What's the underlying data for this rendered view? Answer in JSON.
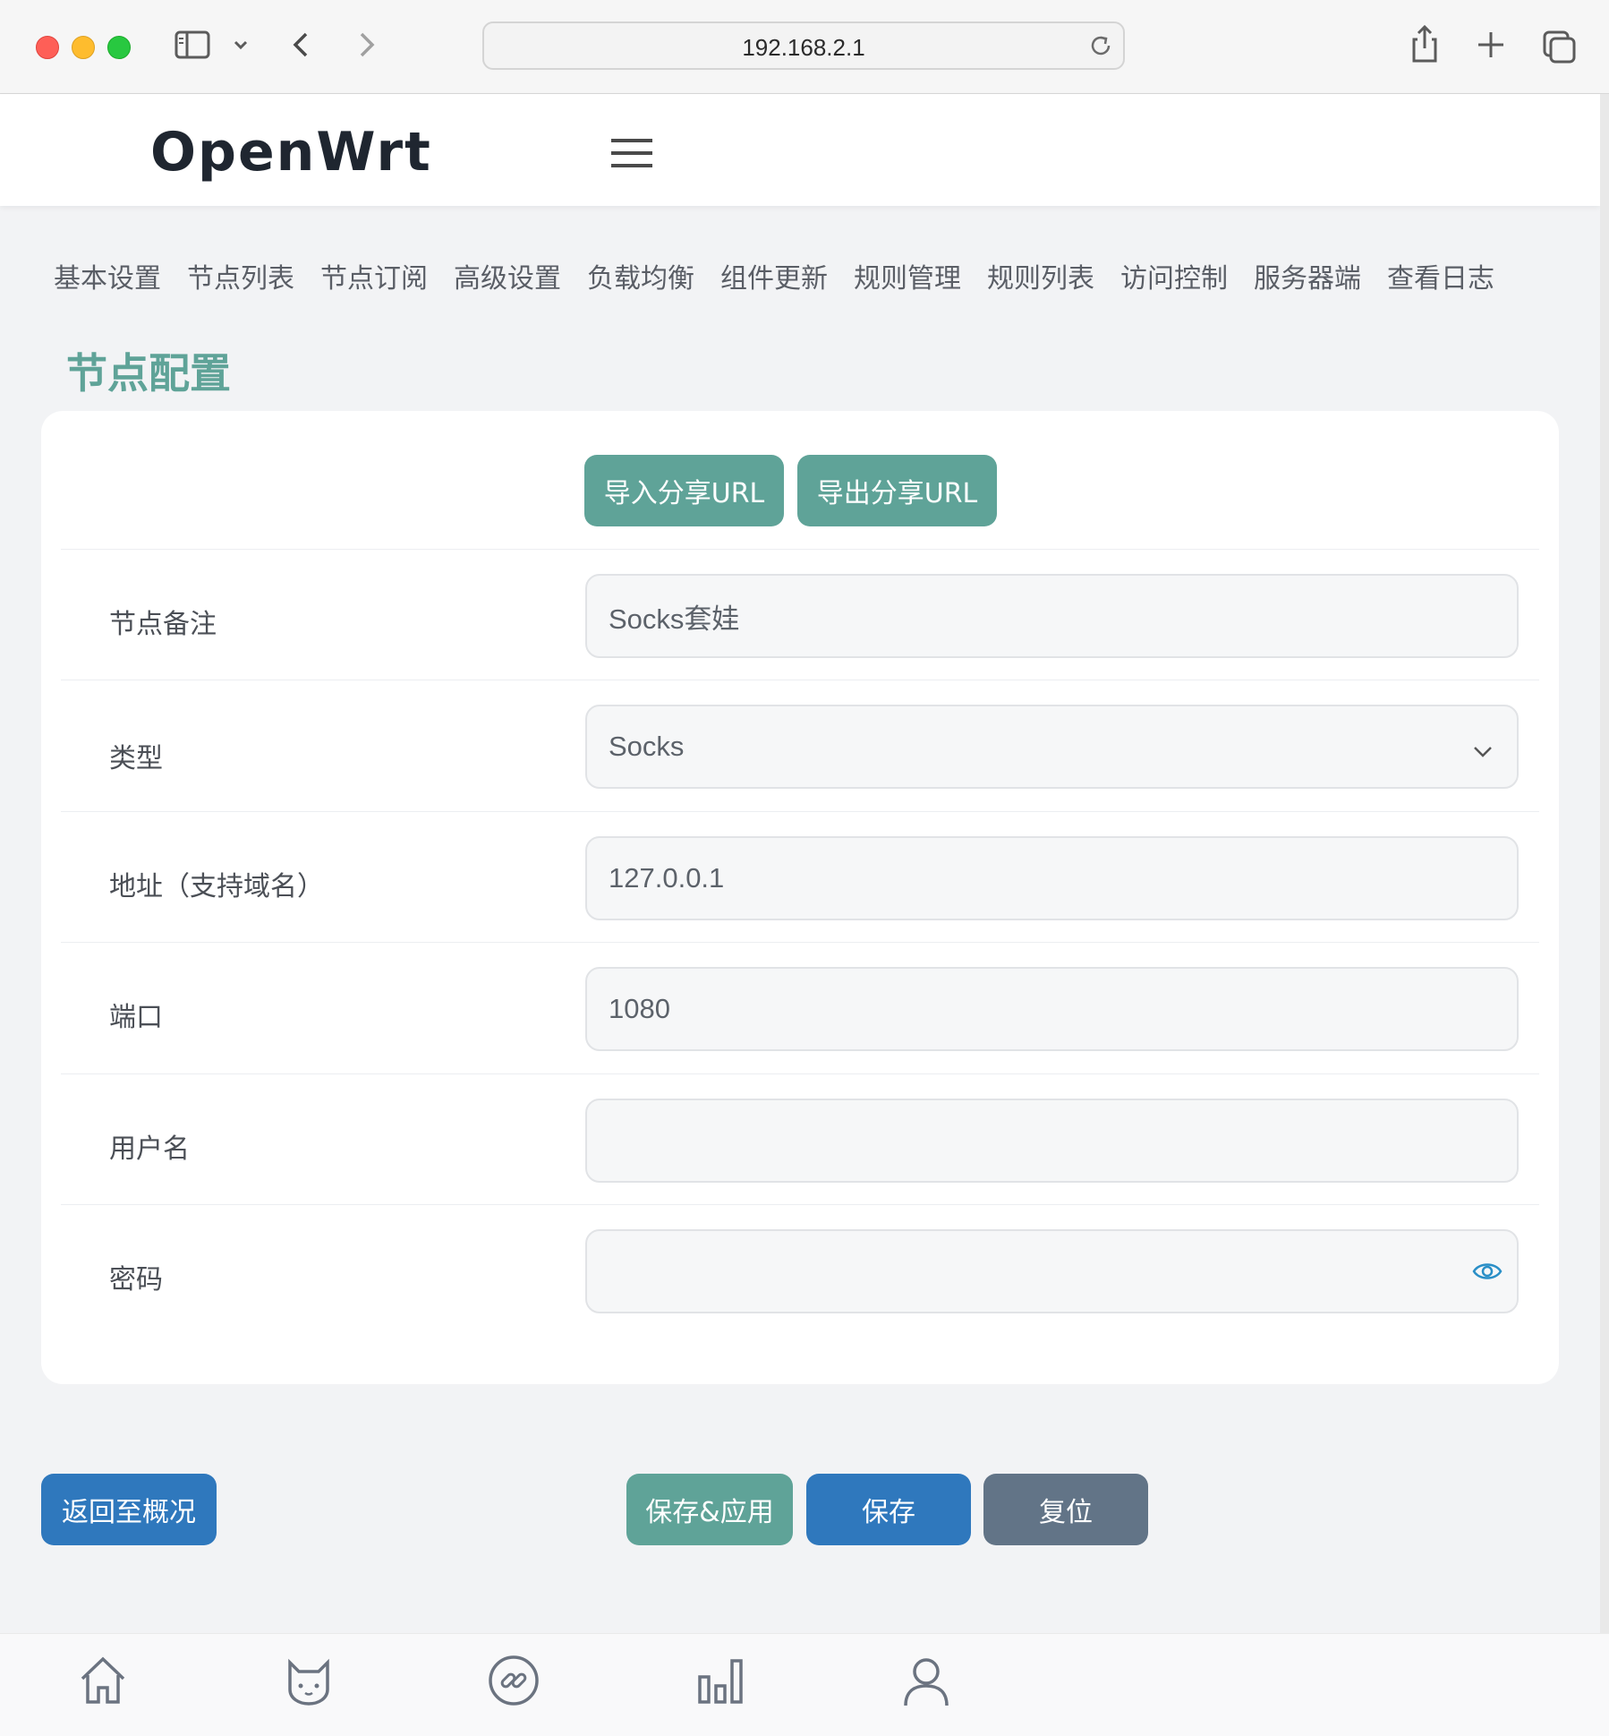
{
  "browser": {
    "url": "192.168.2.1"
  },
  "app": {
    "brand": "OpenWrt"
  },
  "tabs": [
    {
      "label": "基本设置"
    },
    {
      "label": "节点列表"
    },
    {
      "label": "节点订阅"
    },
    {
      "label": "高级设置"
    },
    {
      "label": "负载均衡"
    },
    {
      "label": "组件更新"
    },
    {
      "label": "规则管理"
    },
    {
      "label": "规则列表"
    },
    {
      "label": "访问控制"
    },
    {
      "label": "服务器端"
    },
    {
      "label": "查看日志"
    }
  ],
  "page": {
    "title": "节点配置"
  },
  "share": {
    "import_label": "导入分享URL",
    "export_label": "导出分享URL"
  },
  "form": {
    "remark": {
      "label": "节点备注",
      "value": "Socks套娃"
    },
    "type": {
      "label": "类型",
      "value": "Socks"
    },
    "address": {
      "label": "地址（支持域名）",
      "value": "127.0.0.1"
    },
    "port": {
      "label": "端口",
      "value": "1080"
    },
    "username": {
      "label": "用户名",
      "value": ""
    },
    "password": {
      "label": "密码",
      "value": ""
    }
  },
  "actions": {
    "back": "返回至概况",
    "save_apply": "保存&应用",
    "save": "保存",
    "reset": "复位"
  },
  "bottom_nav": {
    "icons": [
      "home-icon",
      "cat-icon",
      "link-icon",
      "bar-chart-icon",
      "user-icon"
    ]
  },
  "colors": {
    "accent_green": "#5fa398",
    "primary_blue": "#2f78bd",
    "reset_gray": "#627487"
  }
}
